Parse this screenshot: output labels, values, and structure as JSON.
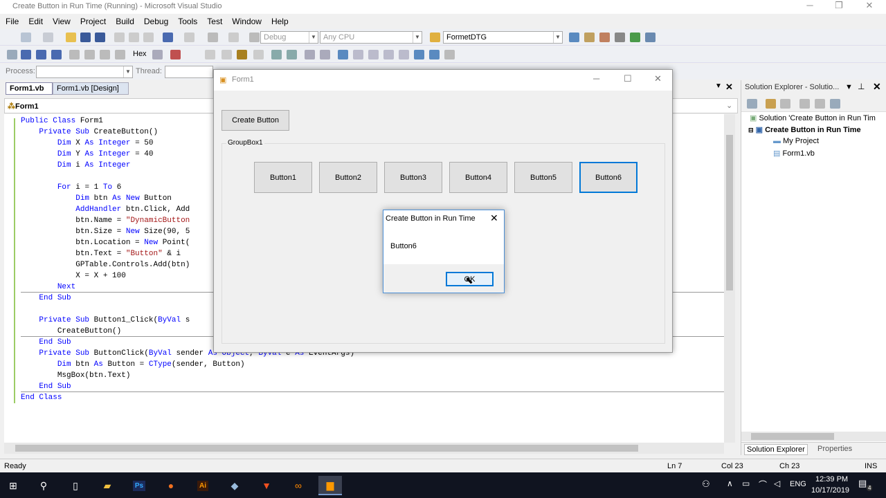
{
  "window": {
    "title": "Create Button in Run Time (Running) - Microsoft Visual Studio"
  },
  "menu": [
    "File",
    "Edit",
    "View",
    "Project",
    "Build",
    "Debug",
    "Tools",
    "Test",
    "Window",
    "Help"
  ],
  "toolbar": {
    "config": "Debug",
    "platform": "Any CPU",
    "project": "FormetDTG",
    "hex": "Hex"
  },
  "procbar": {
    "process_label": "Process:",
    "thread_label": "Thread:"
  },
  "tabs": [
    {
      "label": "Form1.vb"
    },
    {
      "label": "Form1.vb [Design]"
    }
  ],
  "codebar": {
    "class": "Form1"
  },
  "code": [
    {
      "t": "Public Class Form1"
    },
    {
      "t": "    Private Sub CreateButton()"
    },
    {
      "t": "        Dim X As Integer = 50"
    },
    {
      "t": "        Dim Y As Integer = 40"
    },
    {
      "t": "        Dim i As Integer"
    },
    {
      "t": ""
    },
    {
      "t": "        For i = 1 To 6"
    },
    {
      "t": "            Dim btn As New Button"
    },
    {
      "t": "            AddHandler btn.Click, Add"
    },
    {
      "t": "            btn.Name = \"DynamicButton"
    },
    {
      "t": "            btn.Size = New Size(90, 5"
    },
    {
      "t": "            btn.Location = New Point("
    },
    {
      "t": "            btn.Text = \"Button\" & i"
    },
    {
      "t": "            GPTable.Controls.Add(btn)"
    },
    {
      "t": "            X = X + 100"
    },
    {
      "t": "        Next"
    },
    {
      "t": "    End Sub"
    },
    {
      "t": ""
    },
    {
      "t": "    Private Sub Button1_Click(ByVal s"
    },
    {
      "t": "        CreateButton()"
    },
    {
      "t": "    End Sub"
    },
    {
      "t": "    Private Sub ButtonClick(ByVal sender As Object, ByVal e As EventArgs)"
    },
    {
      "t": "        Dim btn As Button = CType(sender, Button)"
    },
    {
      "t": "        MsgBox(btn.Text)"
    },
    {
      "t": "    End Sub"
    },
    {
      "t": "End Class"
    }
  ],
  "status": {
    "ready": "Ready",
    "ln": "Ln 7",
    "col": "Col 23",
    "ch": "Ch 23",
    "ins": "INS"
  },
  "solution_explorer": {
    "title": "Solution Explorer - Solutio...",
    "items": [
      "Solution 'Create Button in Run Tim",
      "Create Button in Run Time",
      "My Project",
      "Form1.vb"
    ],
    "tabs": [
      "Solution Explorer",
      "Properties"
    ]
  },
  "form1": {
    "title": "Form1",
    "create_button": "Create Button",
    "groupbox": "GroupBox1",
    "buttons": [
      "Button1",
      "Button2",
      "Button3",
      "Button4",
      "Button5",
      "Button6"
    ]
  },
  "msgbox": {
    "title": "Create Button in Run Time",
    "text": "Button6",
    "ok": "OK"
  },
  "taskbar": {
    "time": "12:39 PM",
    "date": "10/17/2019",
    "lang": "ENG",
    "notif_count": "4"
  },
  "colors": {
    "accent": "#0078d7",
    "keyword": "#0000ff",
    "string": "#a31515"
  }
}
